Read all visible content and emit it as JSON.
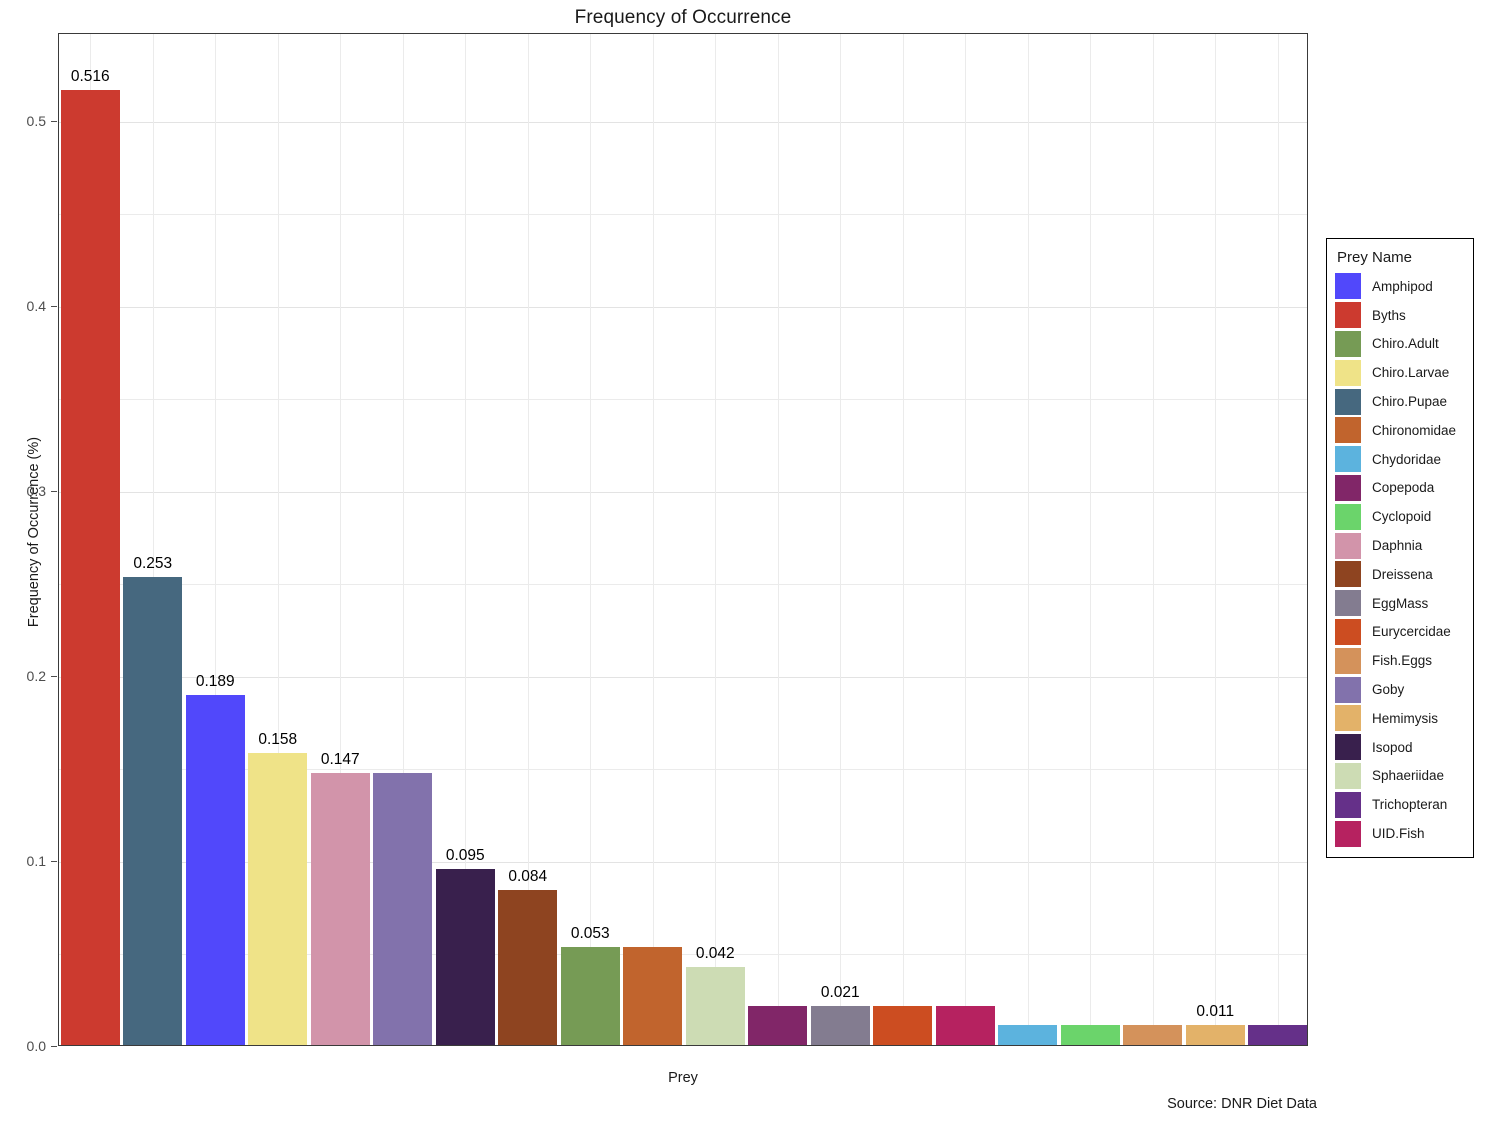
{
  "chart_data": {
    "type": "bar",
    "title": "Frequency of Occurrence",
    "xlabel": "Prey",
    "ylabel": "Frequency of Occurrence (%)",
    "caption": "Source: DNR Diet Data",
    "legend_title": "Prey Name",
    "legend_position": "right",
    "grid": true,
    "ylim": [
      0,
      0.5474
    ],
    "ytick_labels": [
      "0.0",
      "0.1",
      "0.2",
      "0.3",
      "0.4",
      "0.5"
    ],
    "ytick_values": [
      0.0,
      0.1,
      0.2,
      0.3,
      0.4,
      0.5
    ],
    "minor_gridline_values": [
      0.05,
      0.15,
      0.25,
      0.35,
      0.45
    ],
    "categories": [
      "Byths",
      "Chiro.Pupae",
      "Amphipod",
      "Chiro.Larvae",
      "Daphnia",
      "Goby",
      "Isopod",
      "Dreissena",
      "Chiro.Adult",
      "Chironomidae",
      "Sphaeriidae",
      "Copepoda",
      "EggMass",
      "Eurycercidae",
      "UID.Fish",
      "Chydoridae",
      "Cyclopoid",
      "Fish.Eggs",
      "Hemimysis",
      "Trichopteran"
    ],
    "values": [
      0.516,
      0.253,
      0.189,
      0.158,
      0.147,
      0.147,
      0.095,
      0.084,
      0.053,
      0.053,
      0.042,
      0.021,
      0.021,
      0.021,
      0.021,
      0.011,
      0.011,
      0.011,
      0.011,
      0.011
    ],
    "bar_colors": [
      "#cc3a2f",
      "#46687f",
      "#5148fb",
      "#efe388",
      "#d294aa",
      "#8272ac",
      "#39204d",
      "#8e4420",
      "#769b55",
      "#c1642d",
      "#cddcb4",
      "#812668",
      "#837c90",
      "#cc4d21",
      "#b62260",
      "#5cb3de",
      "#6bd46b",
      "#d4925b",
      "#e3b269",
      "#653089"
    ],
    "bar_labels": [
      "0.516",
      "0.253",
      "0.189",
      "0.158",
      "0.147",
      "",
      "0.095",
      "0.084",
      "0.053",
      "",
      "0.042",
      "",
      "0.021",
      "",
      "",
      "",
      "",
      "",
      "0.011",
      ""
    ],
    "legend": [
      {
        "label": "Amphipod",
        "color": "#5148fb"
      },
      {
        "label": "Byths",
        "color": "#cc3a2f"
      },
      {
        "label": "Chiro.Adult",
        "color": "#769b55"
      },
      {
        "label": "Chiro.Larvae",
        "color": "#efe388"
      },
      {
        "label": "Chiro.Pupae",
        "color": "#46687f"
      },
      {
        "label": "Chironomidae",
        "color": "#c1642d"
      },
      {
        "label": "Chydoridae",
        "color": "#5cb3de"
      },
      {
        "label": "Copepoda",
        "color": "#812668"
      },
      {
        "label": "Cyclopoid",
        "color": "#6bd46b"
      },
      {
        "label": "Daphnia",
        "color": "#d294aa"
      },
      {
        "label": "Dreissena",
        "color": "#8e4420"
      },
      {
        "label": "EggMass",
        "color": "#837c90"
      },
      {
        "label": "Eurycercidae",
        "color": "#cc4d21"
      },
      {
        "label": "Fish.Eggs",
        "color": "#d4925b"
      },
      {
        "label": "Goby",
        "color": "#8272ac"
      },
      {
        "label": "Hemimysis",
        "color": "#e3b269"
      },
      {
        "label": "Isopod",
        "color": "#39204d"
      },
      {
        "label": "Sphaeriidae",
        "color": "#cddcb4"
      },
      {
        "label": "Trichopteran",
        "color": "#653089"
      },
      {
        "label": "UID.Fish",
        "color": "#b62260"
      }
    ]
  }
}
